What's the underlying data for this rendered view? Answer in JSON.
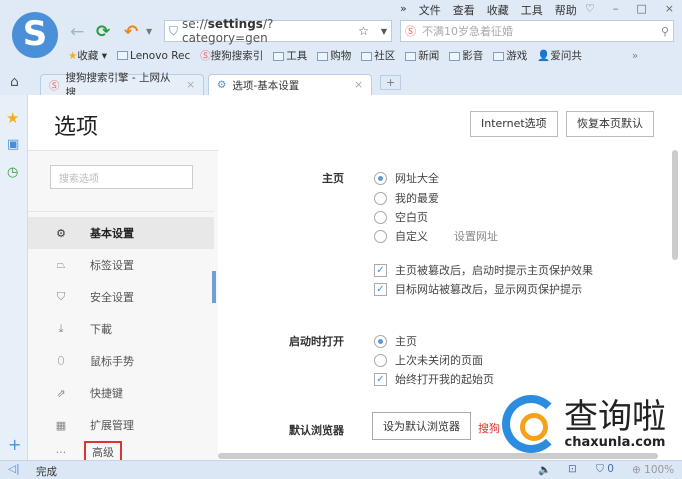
{
  "menu": [
    "»",
    "文件",
    "查看",
    "收藏",
    "工具",
    "帮助"
  ],
  "window_controls": [
    "shirt-icon",
    "minimize",
    "maximize",
    "close"
  ],
  "address": {
    "prefix": "se://",
    "bold": "settings",
    "suffix": "/?category=gen"
  },
  "search_placeholder": "不满10岁急着征婚",
  "bookmarks": {
    "fav": "收藏",
    "items": [
      "Lenovo Rec",
      "搜狗搜索引",
      "工具",
      "购物",
      "社区",
      "新闻",
      "影音",
      "游戏",
      "爱问共"
    ],
    "more": "»"
  },
  "tabs": [
    {
      "label": "搜狗搜索引擎 - 上网从搜"
    },
    {
      "label": "选项-基本设置"
    }
  ],
  "page": {
    "title": "选项",
    "btn_internet": "Internet选项",
    "btn_restore": "恢复本页默认"
  },
  "sidebar": {
    "search_placeholder": "搜索选项",
    "items": [
      "基本设置",
      "标签设置",
      "安全设置",
      "下載",
      "鼠标手势",
      "快捷键",
      "扩展管理",
      "高级"
    ]
  },
  "main": {
    "homepage": {
      "label": "主页",
      "options": [
        "网址大全",
        "我的最爱",
        "空白页",
        "自定义"
      ],
      "set_url": "设置网址",
      "checks": [
        "主页被篡改后，启动时提示主页保护效果",
        "目标网站被篡改后，显示网页保护提示"
      ]
    },
    "startup": {
      "label": "启动时打开",
      "options": [
        "主页",
        "上次未关闭的页面"
      ],
      "check": "始终打开我的起始页"
    },
    "default_browser": {
      "label": "默认浏览器",
      "button": "设为默认浏览器",
      "note": "搜狗"
    }
  },
  "status": {
    "text": "完成",
    "count": "0",
    "zoom": "100%"
  },
  "watermark": {
    "text": "查询啦",
    "url": "chaxunla.com"
  }
}
